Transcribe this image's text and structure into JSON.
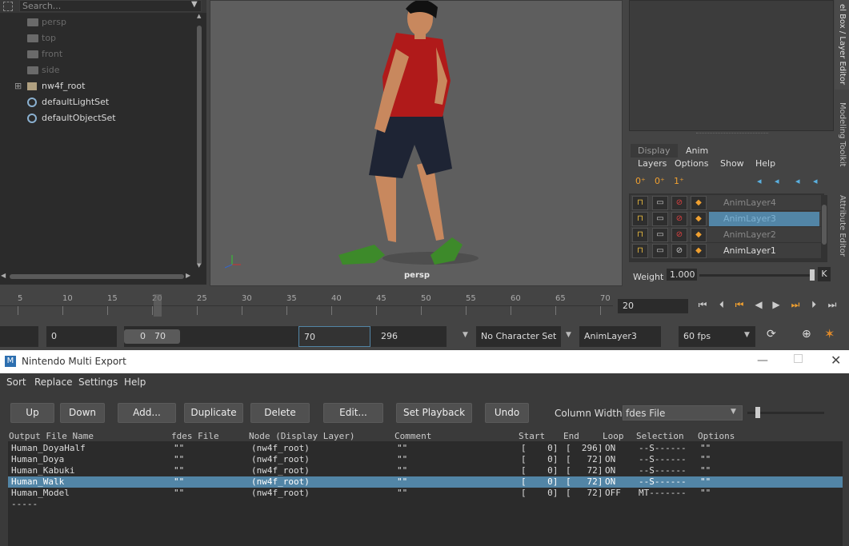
{
  "outliner": {
    "search_placeholder": "Search...",
    "items": [
      {
        "label": "persp",
        "icon": "camera-icon",
        "style": "dim"
      },
      {
        "label": "top",
        "icon": "camera-icon",
        "style": "dim"
      },
      {
        "label": "front",
        "icon": "camera-icon",
        "style": "dim"
      },
      {
        "label": "side",
        "icon": "camera-icon",
        "style": "dim"
      },
      {
        "label": "nw4f_root",
        "icon": "transform-icon",
        "style": "bright",
        "expand": "⊞"
      },
      {
        "label": "defaultLightSet",
        "icon": "set-icon",
        "style": "bright"
      },
      {
        "label": "defaultObjectSet",
        "icon": "set-icon",
        "style": "bright"
      }
    ]
  },
  "viewport": {
    "camera_label": "persp"
  },
  "right_tabs": [
    "el Box / Layer Editor",
    "Modeling Toolkit",
    "Attribute Editor"
  ],
  "layer_editor": {
    "tabs": [
      "Display",
      "Anim"
    ],
    "active_tab": "Anim",
    "menus": [
      "Layers",
      "Options",
      "Show",
      "Help"
    ],
    "layers": [
      {
        "name": "AnimLayer4",
        "selected": false,
        "lock": "locked"
      },
      {
        "name": "AnimLayer3",
        "selected": true,
        "lock": "unlocked"
      },
      {
        "name": "AnimLayer2",
        "selected": false,
        "lock": "unlocked"
      },
      {
        "name": "AnimLayer1",
        "selected": false,
        "lock": "unlocked"
      }
    ],
    "weight_label": "Weight",
    "weight_value": "1.000",
    "key_button": "K"
  },
  "timeline": {
    "ticks": [
      "5",
      "10",
      "15",
      "20",
      "25",
      "30",
      "35",
      "40",
      "45",
      "50",
      "55",
      "60",
      "65",
      "70"
    ],
    "current_frame": "20"
  },
  "range": {
    "start_field": "0",
    "slider_start": "0",
    "slider_end": "70",
    "playback_end": "70",
    "anim_end": "296",
    "character_set": "No Character Set",
    "anim_layer": "AnimLayer3",
    "fps": "60 fps"
  },
  "dialog": {
    "title": "Nintendo Multi Export",
    "menus": [
      "Sort",
      "Replace",
      "Settings",
      "Help"
    ],
    "buttons": [
      "Up",
      "Down",
      "Add...",
      "Duplicate",
      "Delete",
      "Edit...",
      "Set Playback",
      "Undo"
    ],
    "column_width_label": "Column Width",
    "column_width_value": "fdes File",
    "columns": [
      "Output File Name",
      "fdes File",
      "Node (Display Layer)",
      "Comment",
      "Start",
      "End",
      "Loop",
      "Selection",
      "Options"
    ],
    "rows": [
      {
        "name": "Human_DoyaHalf",
        "fdes": "\"\"",
        "node": "(nw4f_root)",
        "comment": "\"\"",
        "start": "[    0]",
        "end": "[  296]",
        "loop": "ON",
        "selection": "--S------",
        "options": "\"\"",
        "selected": false
      },
      {
        "name": "Human_Doya",
        "fdes": "\"\"",
        "node": "(nw4f_root)",
        "comment": "\"\"",
        "start": "[    0]",
        "end": "[   72]",
        "loop": "ON",
        "selection": "--S------",
        "options": "\"\"",
        "selected": false
      },
      {
        "name": "Human_Kabuki",
        "fdes": "\"\"",
        "node": "(nw4f_root)",
        "comment": "\"\"",
        "start": "[    0]",
        "end": "[   72]",
        "loop": "ON",
        "selection": "--S------",
        "options": "\"\"",
        "selected": false
      },
      {
        "name": "Human_Walk",
        "fdes": "\"\"",
        "node": "(nw4f_root)",
        "comment": "\"\"",
        "start": "[    0]",
        "end": "[   72]",
        "loop": "ON",
        "selection": "--S------",
        "options": "\"\"",
        "selected": true
      },
      {
        "name": "Human_Model",
        "fdes": "\"\"",
        "node": "(nw4f_root)",
        "comment": "\"\"",
        "start": "[    0]",
        "end": "[   72]",
        "loop": "OFF",
        "selection": "MT-------",
        "options": "\"\"",
        "selected": false
      },
      {
        "name": "-----",
        "fdes": "",
        "node": "",
        "comment": "",
        "start": "",
        "end": "",
        "loop": "",
        "selection": "",
        "options": "",
        "selected": false
      }
    ]
  }
}
